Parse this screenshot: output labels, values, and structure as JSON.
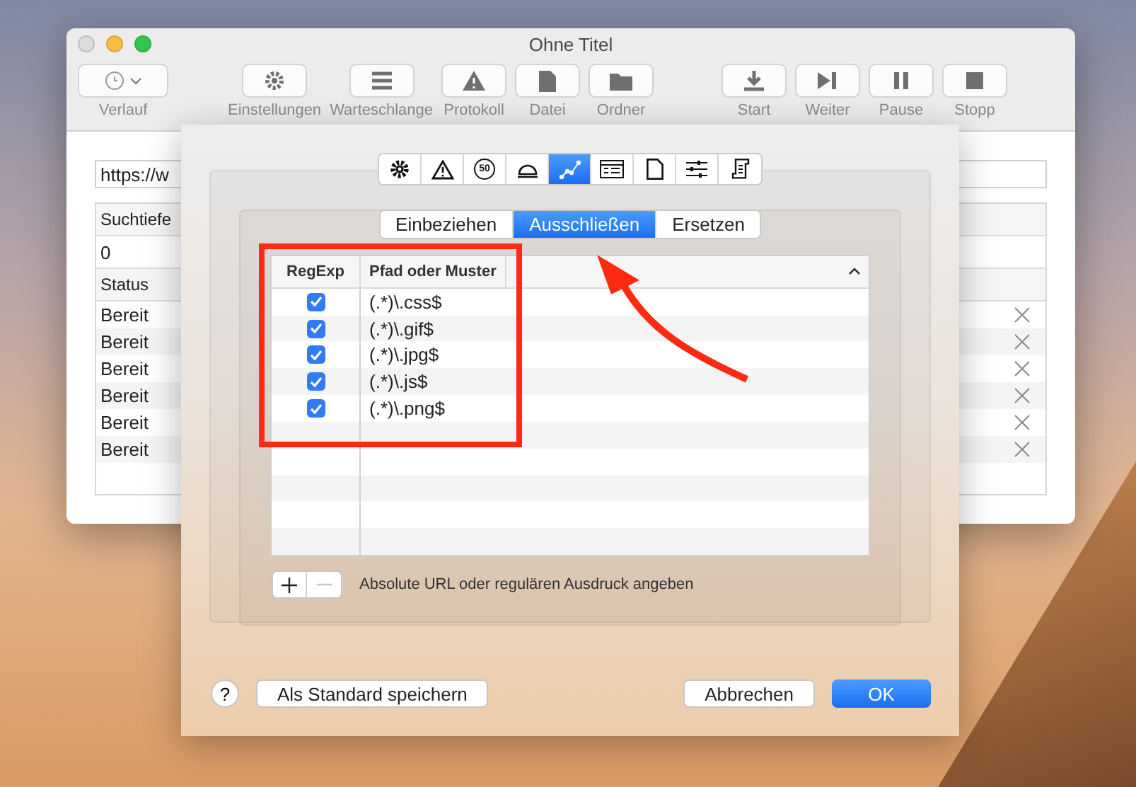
{
  "window": {
    "title": "Ohne Titel"
  },
  "toolbar": {
    "groups": [
      [
        {
          "label": "Verlauf",
          "kind": "dropdown"
        }
      ],
      [
        {
          "label": "Einstellungen",
          "kind": "button"
        },
        {
          "label": "Warteschlange",
          "kind": "button"
        },
        {
          "label": "Protokoll",
          "kind": "button"
        },
        {
          "label": "Datei",
          "kind": "button"
        },
        {
          "label": "Ordner",
          "kind": "button"
        }
      ],
      [
        {
          "label": "Start",
          "kind": "button"
        },
        {
          "label": "Weiter",
          "kind": "button"
        },
        {
          "label": "Pause",
          "kind": "button"
        },
        {
          "label": "Stopp",
          "kind": "button"
        }
      ]
    ]
  },
  "url_field": {
    "value": "https://w"
  },
  "depth": {
    "label": "Suchtiefe",
    "value": "0"
  },
  "status_table": {
    "column": "Status",
    "rows": [
      "Bereit",
      "Bereit",
      "Bereit",
      "Bereit",
      "Bereit",
      "Bereit"
    ]
  },
  "sheet": {
    "icon_tabs": [
      {
        "selected": false
      },
      {
        "selected": false
      },
      {
        "selected": false
      },
      {
        "selected": false
      },
      {
        "selected": true
      },
      {
        "selected": false
      },
      {
        "selected": false
      },
      {
        "selected": false
      },
      {
        "selected": false
      }
    ],
    "speed_badge": "50",
    "segments": [
      {
        "label": "Einbeziehen",
        "selected": false
      },
      {
        "label": "Ausschließen",
        "selected": true
      },
      {
        "label": "Ersetzen",
        "selected": false
      }
    ],
    "table": {
      "columns": [
        "RegExp",
        "Pfad oder Muster"
      ],
      "rows": [
        {
          "regexp": true,
          "pattern": "(.*)\\.css$"
        },
        {
          "regexp": true,
          "pattern": "(.*)\\.gif$"
        },
        {
          "regexp": true,
          "pattern": "(.*)\\.jpg$"
        },
        {
          "regexp": true,
          "pattern": "(.*)\\.js$"
        },
        {
          "regexp": true,
          "pattern": "(.*)\\.png$"
        }
      ]
    },
    "add_button": {
      "disabled": false
    },
    "remove_button": {
      "disabled": true
    },
    "hint": "Absolute URL oder regulären Ausdruck angeben",
    "help": "?",
    "buttons": [
      {
        "label": "Als Standard speichern",
        "kind": "secondary"
      },
      {
        "label": "Abbrechen",
        "kind": "secondary"
      },
      {
        "label": "OK",
        "kind": "default"
      }
    ]
  }
}
